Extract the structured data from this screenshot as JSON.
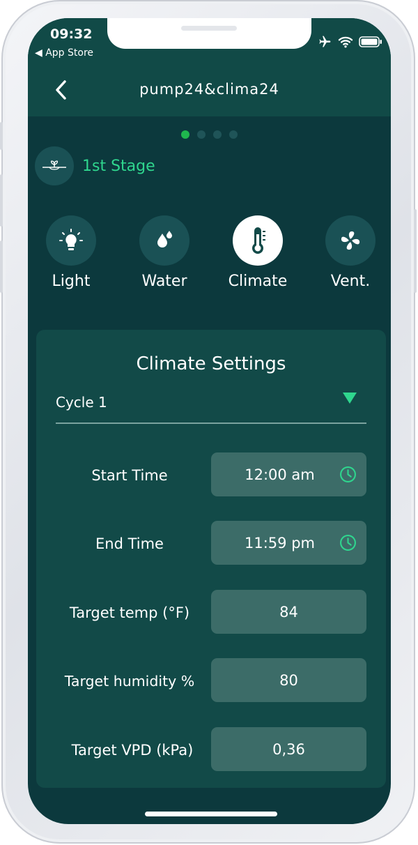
{
  "status": {
    "time": "09:32",
    "back_app": "◀ App Store"
  },
  "header": {
    "title": "pump24&clima24"
  },
  "pager": {
    "count": 4,
    "active": 0
  },
  "stage": {
    "label": "1st Stage"
  },
  "categories": [
    {
      "label": "Light",
      "icon": "lightbulb-icon"
    },
    {
      "label": "Water",
      "icon": "water-drop-icon"
    },
    {
      "label": "Climate",
      "icon": "thermometer-icon",
      "active": true
    },
    {
      "label": "Vent.",
      "icon": "fan-icon"
    }
  ],
  "settings": {
    "title": "Climate Settings",
    "cycle": "Cycle 1",
    "rows": [
      {
        "label": "Start Time",
        "value": "12:00 am"
      },
      {
        "label": "End Time",
        "value": "11:59 pm"
      },
      {
        "label": "Target temp (°F)",
        "value": "84"
      },
      {
        "label": "Target humidity %",
        "value": "80"
      },
      {
        "label": "Target VPD (kPa)",
        "value": "0,36"
      }
    ]
  },
  "colors": {
    "background": "#0c393d",
    "header": "#114a47",
    "card": "#124a48",
    "field": "#3c6c68",
    "accent_green": "#2fd68e",
    "active_dot": "#1fb64e"
  }
}
